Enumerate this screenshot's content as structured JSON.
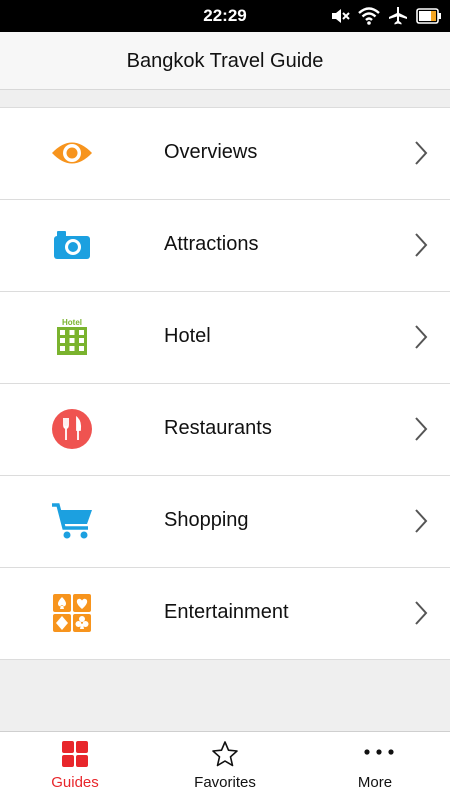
{
  "status_bar": {
    "time": "22:29",
    "icons": [
      "mute-icon",
      "wifi-icon",
      "airplane-icon",
      "battery-icon"
    ]
  },
  "header": {
    "title": "Bangkok Travel Guide"
  },
  "menu": {
    "items": [
      {
        "label": "Overviews",
        "icon": "eye-icon",
        "color": "#f7941d"
      },
      {
        "label": "Attractions",
        "icon": "camera-icon",
        "color": "#1ca0e0"
      },
      {
        "label": "Hotel",
        "icon": "hotel-icon",
        "color": "#7ab32e",
        "icon_text": "Hotel"
      },
      {
        "label": "Restaurants",
        "icon": "fork-knife-icon",
        "color": "#ef5350"
      },
      {
        "label": "Shopping",
        "icon": "cart-icon",
        "color": "#1ca0e0"
      },
      {
        "label": "Entertainment",
        "icon": "cards-icon",
        "color": "#f7941d"
      }
    ]
  },
  "tab_bar": {
    "tabs": [
      {
        "label": "Guides",
        "icon": "grid-icon",
        "active": true,
        "color": "#e8262b"
      },
      {
        "label": "Favorites",
        "icon": "star-icon",
        "active": false
      },
      {
        "label": "More",
        "icon": "more-dots-icon",
        "active": false
      }
    ]
  }
}
